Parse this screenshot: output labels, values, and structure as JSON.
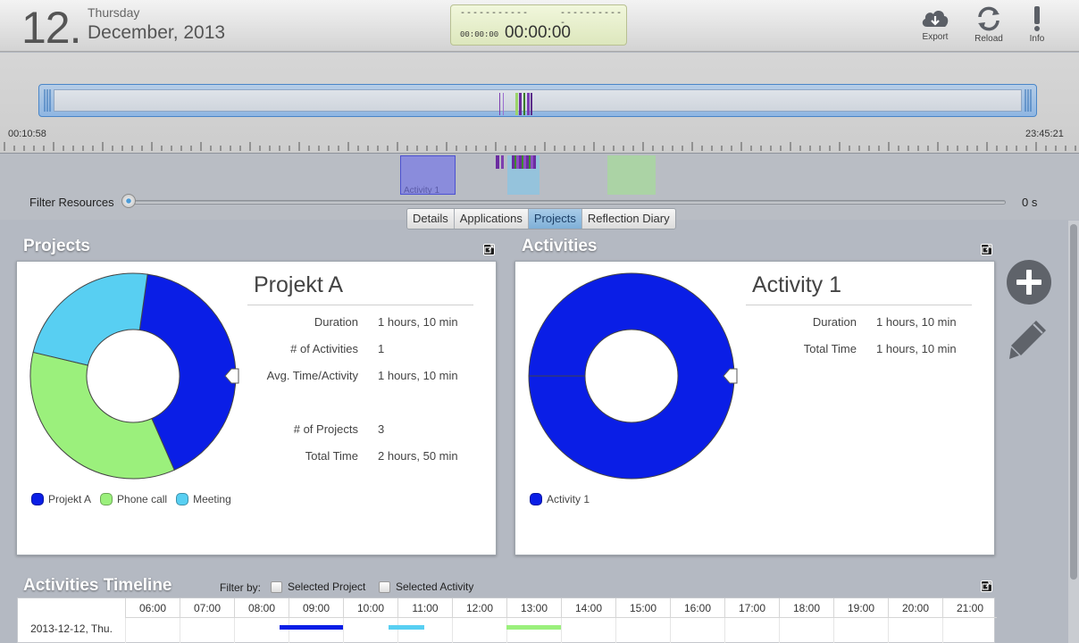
{
  "header": {
    "day_number": "12.",
    "weekday": "Thursday",
    "month_year": "December, 2013",
    "timer": {
      "dash_left": "-----------",
      "dash_right": "-----------",
      "small_time": "00:00:00",
      "big_time": "00:00:00"
    },
    "buttons": {
      "export_label": "Export",
      "reload_label": "Reload",
      "info_label": "Info"
    }
  },
  "overview": {
    "start_time": "00:10:58",
    "end_time": "23:45:21"
  },
  "resources": {
    "block_label": "Activity 1",
    "filter_label": "Filter Resources",
    "filter_value": "0 s",
    "filter_level": 0
  },
  "tabs": [
    {
      "label": "Details",
      "active": false
    },
    {
      "label": "Applications",
      "active": false
    },
    {
      "label": "Projects",
      "active": true
    },
    {
      "label": "Reflection Diary",
      "active": false
    }
  ],
  "projects_panel": {
    "title": "Projects",
    "heading": "Projekt A",
    "stats": [
      {
        "label": "Duration",
        "value": "1 hours, 10 min"
      },
      {
        "label": "# of Activities",
        "value": "1"
      },
      {
        "label": "Avg. Time/Activity",
        "value": "1 hours, 10 min"
      },
      {
        "label": "# of Projects",
        "value": "3"
      },
      {
        "label": "Total Time",
        "value": "2 hours, 50 min"
      }
    ],
    "legend": [
      {
        "label": "Projekt A",
        "color": "#0a1ee6"
      },
      {
        "label": "Phone call",
        "color": "#9bf07c"
      },
      {
        "label": "Meeting",
        "color": "#58cff2"
      }
    ]
  },
  "activities_panel": {
    "title": "Activities",
    "heading": "Activity 1",
    "stats": [
      {
        "label": "Duration",
        "value": "1 hours, 10 min"
      },
      {
        "label": "Total Time",
        "value": "1 hours, 10 min"
      }
    ],
    "legend": [
      {
        "label": "Activity 1",
        "color": "#0a1ee6"
      }
    ]
  },
  "chart_data": [
    {
      "type": "pie",
      "title": "Projekt A",
      "categories": [
        "Projekt A",
        "Phone call",
        "Meeting"
      ],
      "values": [
        70,
        60,
        40
      ],
      "colors": [
        "#0a1ee6",
        "#9bf07c",
        "#58cff2"
      ],
      "donut": true,
      "legend_position": "bottom-left"
    },
    {
      "type": "pie",
      "title": "Activity 1",
      "categories": [
        "Activity 1"
      ],
      "values": [
        70
      ],
      "colors": [
        "#0a1ee6"
      ],
      "donut": true,
      "legend_position": "bottom-left"
    }
  ],
  "timeline": {
    "title": "Activities Timeline",
    "filter_label": "Filter by:",
    "filter_options": [
      {
        "label": "Selected Project",
        "checked": false
      },
      {
        "label": "Selected Activity",
        "checked": false
      }
    ],
    "hours": [
      "06:00",
      "07:00",
      "08:00",
      "09:00",
      "10:00",
      "11:00",
      "12:00",
      "13:00",
      "14:00",
      "15:00",
      "16:00",
      "17:00",
      "18:00",
      "19:00",
      "20:00",
      "21:00"
    ],
    "row_label": "2013-12-12, Thu.",
    "bars": [
      {
        "name": "Projekt A",
        "start": "08:50",
        "end": "10:00",
        "color": "#0a1ee6"
      },
      {
        "name": "Meeting",
        "start": "10:50",
        "end": "11:30",
        "color": "#58cff2"
      },
      {
        "name": "Phone call",
        "start": "13:00",
        "end": "14:00",
        "color": "#9bf07c"
      }
    ]
  },
  "icons": {
    "export": "cloud-download-icon",
    "reload": "reload-icon",
    "info": "info-icon",
    "add": "plus-circle-icon",
    "edit": "pencil-icon",
    "popout": "popout-icon"
  }
}
